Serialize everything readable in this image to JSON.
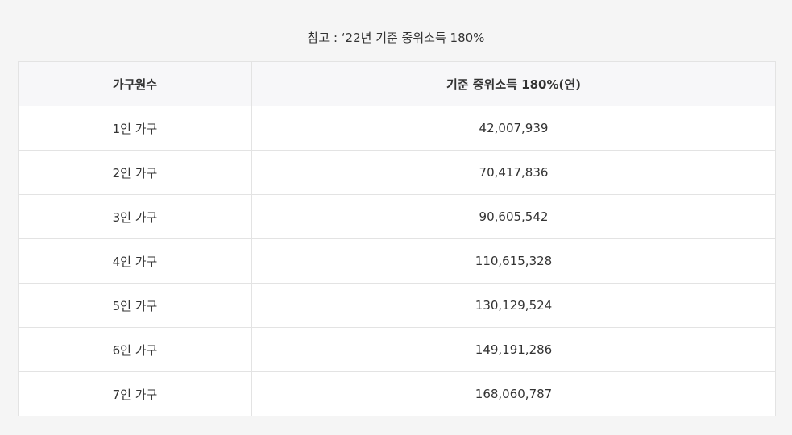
{
  "caption": "참고 : ‘22년 기준 중위소득 180%",
  "table": {
    "headers": [
      "가구원수",
      "기준 중위소득 180%(연)"
    ],
    "rows": [
      [
        "1인 가구",
        "42,007,939"
      ],
      [
        "2인 가구",
        "70,417,836"
      ],
      [
        "3인 가구",
        "90,605,542"
      ],
      [
        "4인 가구",
        "110,615,328"
      ],
      [
        "5인 가구",
        "130,129,524"
      ],
      [
        "6인 가구",
        "149,191,286"
      ],
      [
        "7인 가구",
        "168,060,787"
      ]
    ]
  },
  "colors": {
    "page_background": "#f5f5f5",
    "header_background": "#f7f7f9",
    "border": "#e3e3e3",
    "text": "#333333"
  }
}
